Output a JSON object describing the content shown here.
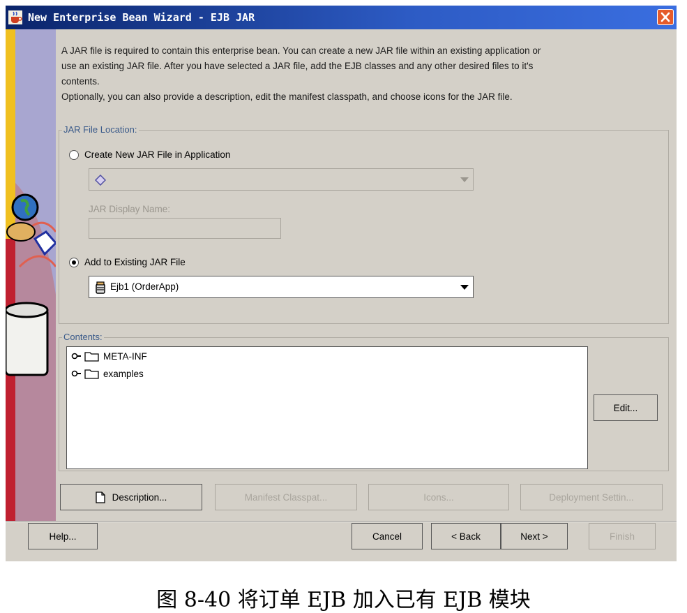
{
  "window": {
    "title": "New Enterprise Bean Wizard - EJB JAR"
  },
  "intro": {
    "line1": "A JAR file is required to contain this enterprise bean. You can create a new JAR file within an existing application or",
    "line2": "use an existing JAR file.  After you have selected a JAR file, add the EJB classes and any other desired files to it's",
    "line3": "contents.",
    "line4": "Optionally, you can also provide a description, edit the manifest classpath, and choose icons for the JAR file."
  },
  "jar_location": {
    "legend": "JAR File Location:",
    "create_new_label": "Create New JAR File in Application",
    "create_new_selected": false,
    "application_combo_value": "",
    "display_name_label": "JAR Display Name:",
    "display_name_value": "",
    "add_existing_label": "Add to Existing JAR File",
    "add_existing_selected": true,
    "existing_jar_value": "Ejb1 (OrderApp)"
  },
  "contents": {
    "legend": "Contents:",
    "items": [
      "META-INF",
      "examples"
    ],
    "edit_button": "Edit..."
  },
  "tab_buttons": {
    "description": "Description...",
    "manifest": "Manifest Classpat...",
    "icons": "Icons...",
    "deployment": "Deployment Settin..."
  },
  "nav_buttons": {
    "help": "Help...",
    "cancel": "Cancel",
    "back": "< Back",
    "next": "Next >",
    "finish": "Finish"
  },
  "caption": "图 8-40 将订单 EJB 加入已有 EJB 模块",
  "colors": {
    "dialog_bg": "#d4d0c8",
    "titlebar": "#0a246a",
    "close_button": "#e55b2b"
  }
}
